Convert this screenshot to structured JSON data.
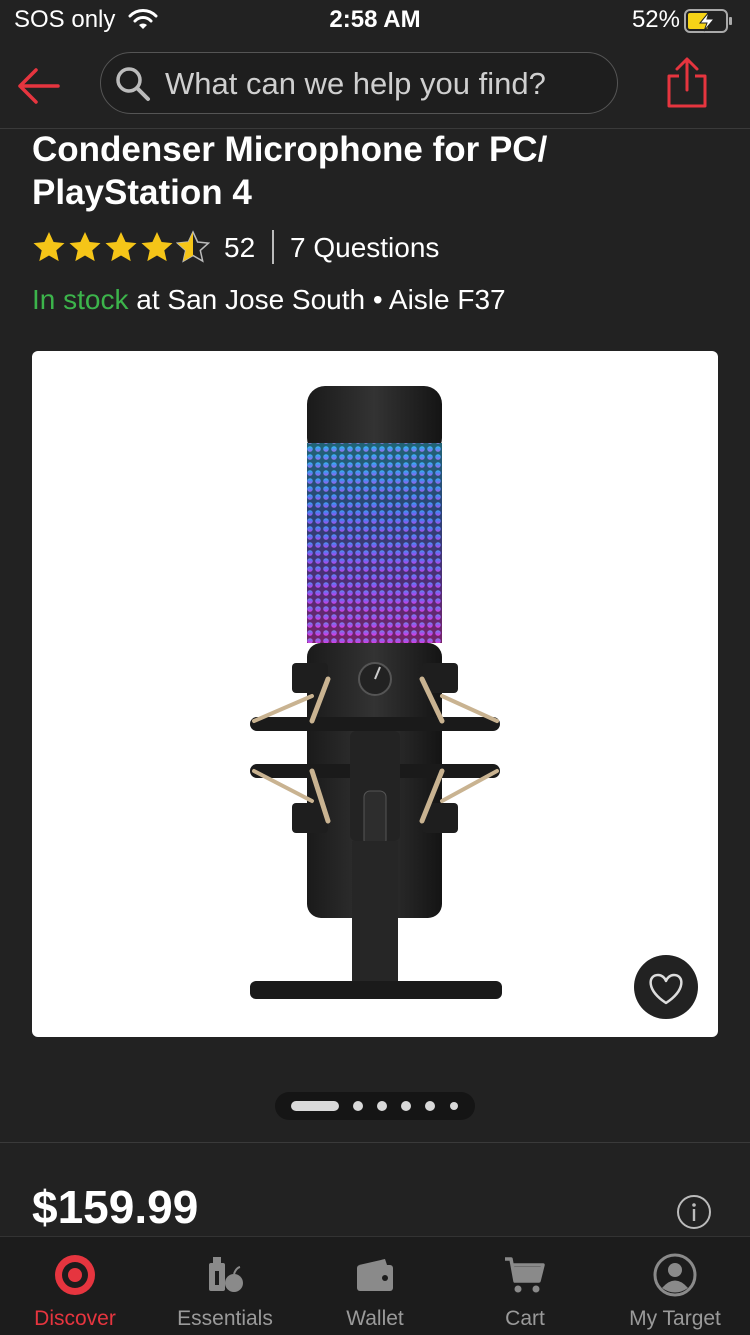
{
  "status_bar": {
    "carrier": "SOS only",
    "time": "2:58 AM",
    "battery_percent": "52%",
    "icons": [
      "wifi-icon",
      "battery-charging-icon"
    ]
  },
  "header": {
    "back_icon": "back-arrow-icon",
    "search_placeholder": "What can we help you find?",
    "share_icon": "share-icon"
  },
  "product": {
    "title": "Condenser Microphone for PC/ PlayStation 4",
    "rating": 4.5,
    "rating_count": "52",
    "questions": "7 Questions",
    "stock_status": "In stock",
    "stock_location": " at San Jose South • Aisle F37",
    "price": "$159.99",
    "image_count": 6,
    "active_image": 1
  },
  "colors": {
    "accent": "#e6353f",
    "in_stock": "#3cb44b",
    "background": "#222222"
  },
  "tab_bar": {
    "tabs": [
      {
        "label": "Discover",
        "icon": "target-logo-icon",
        "active": true
      },
      {
        "label": "Essentials",
        "icon": "essentials-icon",
        "active": false
      },
      {
        "label": "Wallet",
        "icon": "wallet-icon",
        "active": false
      },
      {
        "label": "Cart",
        "icon": "cart-icon",
        "active": false
      },
      {
        "label": "My Target",
        "icon": "account-icon",
        "active": false
      }
    ]
  }
}
